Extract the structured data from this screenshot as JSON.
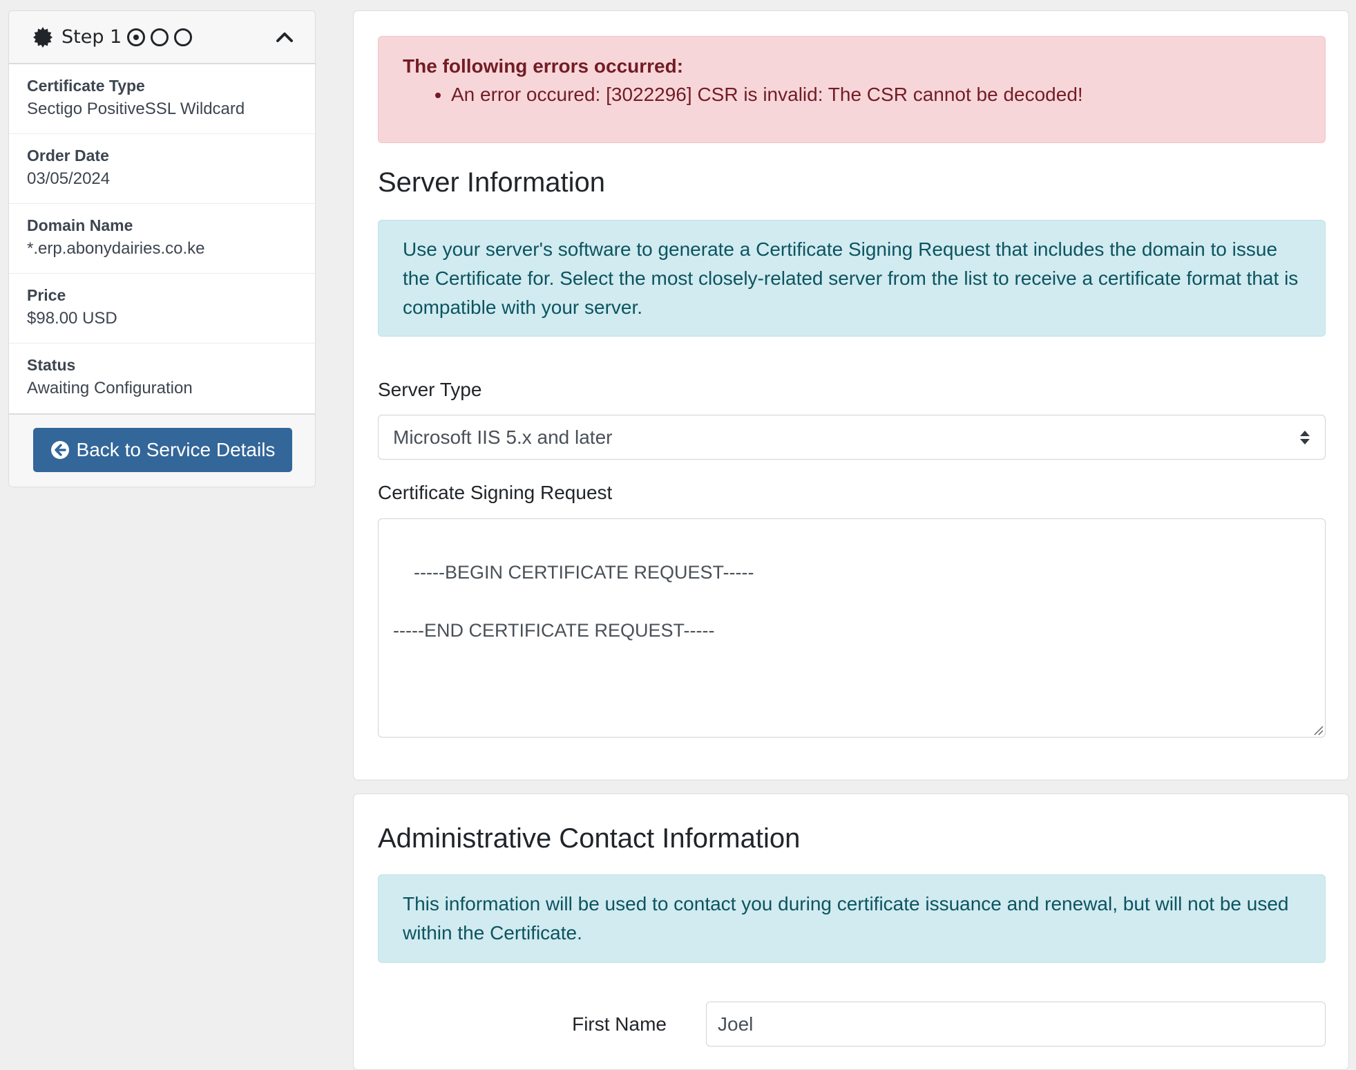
{
  "sidebar": {
    "step_label": "Step 1",
    "steps": [
      {
        "state": "current"
      },
      {
        "state": "pending"
      },
      {
        "state": "pending"
      }
    ],
    "rows": [
      {
        "label": "Certificate Type",
        "value": "Sectigo PositiveSSL Wildcard"
      },
      {
        "label": "Order Date",
        "value": "03/05/2024"
      },
      {
        "label": "Domain Name",
        "value": "*.erp.abonydairies.co.ke"
      },
      {
        "label": "Price",
        "value": "$98.00 USD"
      },
      {
        "label": "Status",
        "value": "Awaiting Configuration"
      }
    ],
    "back_button_label": "Back to Service Details"
  },
  "errors": {
    "title": "The following errors occurred:",
    "items": [
      "An error occured: [3022296] CSR is invalid: The CSR cannot be decoded!"
    ]
  },
  "server_info": {
    "title": "Server Information",
    "info_text": "Use your server's software to generate a Certificate Signing Request that includes the domain to issue the Certificate for. Select the most closely-related server from the list to receive a certificate format that is compatible with your server.",
    "server_type_label": "Server Type",
    "server_type_value": "Microsoft IIS 5.x and later",
    "csr_label": "Certificate Signing Request",
    "csr_value": "-----BEGIN CERTIFICATE REQUEST-----\n\n-----END CERTIFICATE REQUEST-----"
  },
  "admin_contact": {
    "title": "Administrative Contact Information",
    "info_text": "This information will be used to contact you during certificate issuance and renewal, but will not be used within the Certificate.",
    "first_name_label": "First Name",
    "first_name_value": "Joel"
  },
  "colors": {
    "primary_button": "#336699",
    "danger_bg": "#f7d6da",
    "danger_text": "#721c24",
    "info_bg": "#d1ebf0",
    "info_text": "#0c5460",
    "page_bg": "#efefef"
  }
}
